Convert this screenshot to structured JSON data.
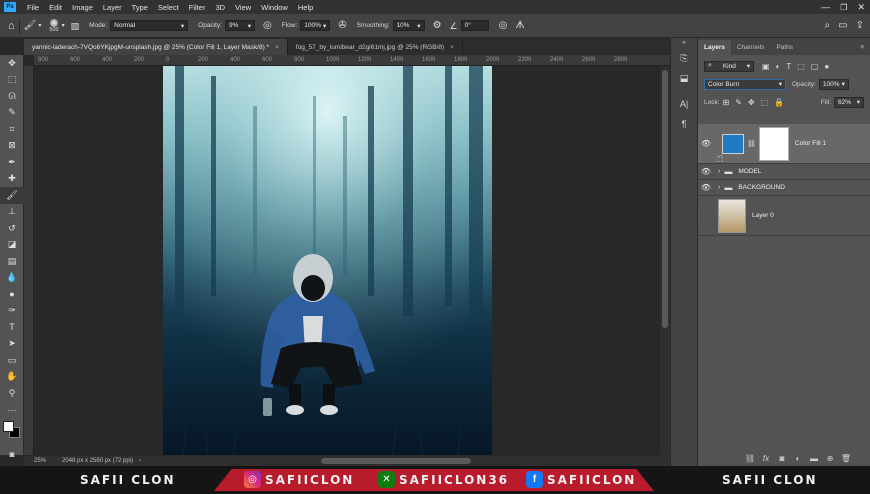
{
  "menubar": {
    "logo": "Ps",
    "items": [
      "File",
      "Edit",
      "Image",
      "Layer",
      "Type",
      "Select",
      "Filter",
      "3D",
      "View",
      "Window",
      "Help"
    ]
  },
  "options": {
    "brush_size": "500",
    "mode_label": "Mode:",
    "mode_value": "Normal",
    "opacity_label": "Opacity:",
    "opacity_value": "9%",
    "flow_label": "Flow:",
    "flow_value": "100%",
    "smoothing_label": "Smoothing:",
    "smoothing_value": "10%",
    "angle_value": "0°"
  },
  "tabs": [
    {
      "label": "yannic-laderach-7VQo6YKjpgM-unsplash.jpg @ 25% (Color Fill 1, Layer Mask/8) *",
      "close": "×"
    },
    {
      "label": "fog_57_by_lumibear_d2gi61mj.jpg @ 25% (RGB/8)",
      "close": "×"
    }
  ],
  "ruler_labels": [
    "800",
    "600",
    "400",
    "200",
    "0",
    "200",
    "400",
    "600",
    "800",
    "1000",
    "1200",
    "1400",
    "1600",
    "1800",
    "2000",
    "2200",
    "2400",
    "2600",
    "2800"
  ],
  "status": {
    "zoom": "25%",
    "doc_info": "2048 px x 2560 px (72 ppi)"
  },
  "layers_panel": {
    "tabs": [
      "Layers",
      "Channels",
      "Paths"
    ],
    "filter_kind": "Kind",
    "blend_mode": "Color Burn",
    "opacity_label": "Opacity:",
    "opacity_value": "100%",
    "lock_label": "Lock:",
    "fill_label": "Fill:",
    "fill_value": "62%",
    "layers": [
      {
        "name": "Color Fill 1"
      },
      {
        "name": "MODEL"
      },
      {
        "name": "BACKGROUND"
      },
      {
        "name": "Layer 0"
      }
    ]
  },
  "banner": {
    "left": "SAFII CLON",
    "instagram": "SAFIICLON",
    "xbox": "SAFIICLON36",
    "facebook": "SAFIICLON",
    "right": "SAFII CLON"
  },
  "colors": {
    "accent": "#31a8ff",
    "banner_red": "#b81b2b",
    "fill_swatch": "#1f7bc4"
  }
}
